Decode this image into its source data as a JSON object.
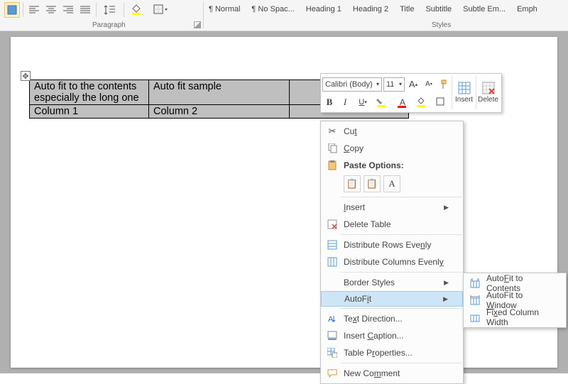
{
  "ribbon": {
    "paragraph_label": "Paragraph",
    "styles_label": "Styles",
    "styles": [
      "¶ Normal",
      "¶ No Spac...",
      "Heading 1",
      "Heading 2",
      "Title",
      "Subtitle",
      "Subtle Em...",
      "Emph"
    ]
  },
  "table": {
    "r1c1": "Auto fit to the contents especially the long one",
    "r1c2": "Auto fit sample",
    "r2c1": "Column 1",
    "r2c2": "Column 2"
  },
  "mini": {
    "font": "Calibri (Body)",
    "size": "11",
    "insert": "Insert",
    "delete": "Delete"
  },
  "ctx": {
    "cut": "Cut",
    "copy": "Copy",
    "paste_options": "Paste Options:",
    "insert": "Insert",
    "delete_table": "Delete Table",
    "dist_rows": "Distribute Rows Evenly",
    "dist_cols": "Distribute Columns Evenly",
    "border_styles": "Border Styles",
    "autofit": "AutoFit",
    "text_direction": "Text Direction...",
    "insert_caption": "Insert Caption...",
    "table_properties": "Table Properties...",
    "new_comment": "New Comment"
  },
  "autofit_sub": {
    "contents": "AutoFit to Contents",
    "window": "AutoFit to Window",
    "fixed": "Fixed Column Width"
  }
}
